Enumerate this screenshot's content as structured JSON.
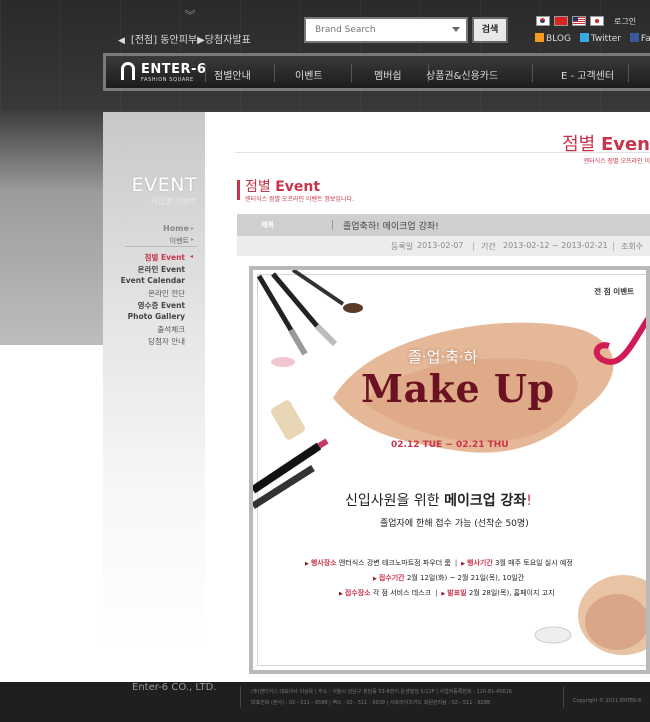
{
  "header": {
    "notice_text": "[전점] 동안피부▶당첨자발표",
    "search_placeholder": "Brand Search",
    "search_button": "검색",
    "login": "로그인",
    "social": {
      "blog": "BLOG",
      "twitter": "Twitter",
      "facebook": "Facebo"
    }
  },
  "nav": {
    "logo_main": "ENTER-6",
    "logo_sub": "FASHION SQUARE",
    "items": [
      "점별안내",
      "이벤트",
      "멤버쉽",
      "상품권&신용카드",
      "E - 고객센터"
    ]
  },
  "sidebar": {
    "title": "EVENT",
    "subtitle": "지점별 이벤트",
    "home": "Home",
    "breadcrumb": "이벤트",
    "menu": [
      "점별 Event",
      "온라인 Event",
      "Event Calendar",
      "온라인 전단",
      "영수증 Event",
      "Photo Gallery",
      "출석체크",
      "당첨자 안내"
    ]
  },
  "main": {
    "header_title_pre": "점별 ",
    "header_title_bold": "Even",
    "header_subtitle": "엔터식스 점별 오프라인 이",
    "section_title_pre": "점별 ",
    "section_title_bold": "Event",
    "section_subtitle": "엔터식스 점별 오프라인 이벤트 정보입니다.",
    "article": {
      "title_label": "제목",
      "title": "졸업축하! 메이크업 강좌!",
      "reg_label": "등록일",
      "reg_date": "2013-02-07",
      "period_label": "기간",
      "period": "2013-02-12 ~ 2013-02-21",
      "views_label": "조회수"
    }
  },
  "poster": {
    "corner_label": "전 점 이벤트",
    "small_title": "졸·업·축·하",
    "big_title": "Make Up",
    "dates": "02.12 TUE ~ 02.21 THU",
    "headline_pre": "신입사원을 위한 ",
    "headline_bold": "메이크업 강좌",
    "headline_end": "!",
    "subhead": "졸업자에 한해 접수 가능 (선착순 50명)",
    "info": {
      "place_label": "행사장소",
      "place": "엔터식스 강변 테크노마트점 파우더 룸",
      "time_label": "행사기간",
      "time": "3월 매주 토요일 실시 예정",
      "apply_period_label": "접수기간",
      "apply_period": "2월 12일(화) ~ 2월 21일(목), 10일간",
      "apply_place_label": "접수장소",
      "apply_place": "각 점 서비스 데스크",
      "announce_label": "발표일",
      "announce": "2월 28일(목), 홈페이지 고지"
    }
  },
  "footer": {
    "brand": "Enter-6 CO., LTD.",
    "line1": "(주)엔터식스 대표이사 이상욱 | 주소 : 서울시 강남구 청담동 53-8번지 운생빌딩 5/12F | 사업자등록번호 : 120-81-45616",
    "line2": "대표전화 (본사) : 02 - 511 - 8588 | 팩스 : 02 - 511 - 9939 | 서포라이즈카드 회원관리팀 : 02 - 511 - 8288",
    "copyright": "Copyright © 2011 ENTER-6"
  },
  "colors": {
    "accent": "#c8344b",
    "title_dark": "#6b1222",
    "nav_bg": "#1c1c1c"
  }
}
